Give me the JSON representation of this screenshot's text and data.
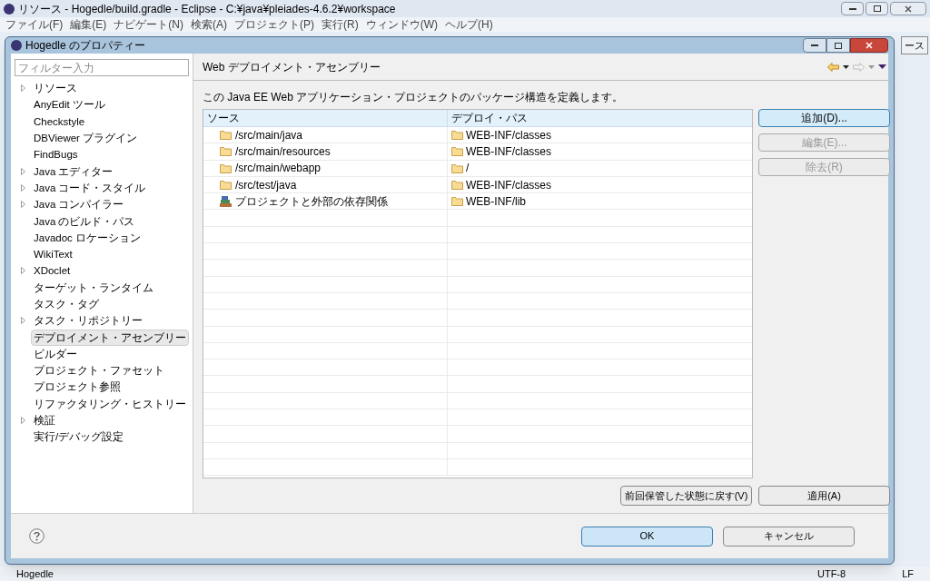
{
  "main_window": {
    "title": "リソース - Hogedle/build.gradle - Eclipse - C:¥java¥pleiades-4.6.2¥workspace",
    "menu": [
      "ファイル(F)",
      "編集(E)",
      "ナビゲート(N)",
      "検索(A)",
      "プロジェクト(P)",
      "実行(R)",
      "ウィンドウ(W)",
      "ヘルプ(H)"
    ],
    "perspective_tab": "ース",
    "status_project": "Hogedle",
    "status_encoding": "UTF-8",
    "status_line_ending": "LF"
  },
  "dialog": {
    "title": "Hogedle のプロパティー",
    "filter": {
      "placeholder": "フィルター入力"
    },
    "tree": [
      {
        "label": "リソース",
        "expandable": true,
        "selected": false
      },
      {
        "label": "AnyEdit ツール",
        "expandable": false,
        "selected": false
      },
      {
        "label": "Checkstyle",
        "expandable": false,
        "selected": false
      },
      {
        "label": "DBViewer プラグイン",
        "expandable": false,
        "selected": false
      },
      {
        "label": "FindBugs",
        "expandable": false,
        "selected": false
      },
      {
        "label": "Java エディター",
        "expandable": true,
        "selected": false
      },
      {
        "label": "Java コード・スタイル",
        "expandable": true,
        "selected": false
      },
      {
        "label": "Java コンパイラー",
        "expandable": true,
        "selected": false
      },
      {
        "label": "Java のビルド・パス",
        "expandable": false,
        "selected": false
      },
      {
        "label": "Javadoc ロケーション",
        "expandable": false,
        "selected": false
      },
      {
        "label": "WikiText",
        "expandable": false,
        "selected": false
      },
      {
        "label": "XDoclet",
        "expandable": true,
        "selected": false
      },
      {
        "label": "ターゲット・ランタイム",
        "expandable": false,
        "selected": false
      },
      {
        "label": "タスク・タグ",
        "expandable": false,
        "selected": false
      },
      {
        "label": "タスク・リポジトリー",
        "expandable": true,
        "selected": false
      },
      {
        "label": "デプロイメント・アセンブリー",
        "expandable": false,
        "selected": true
      },
      {
        "label": "ビルダー",
        "expandable": false,
        "selected": false
      },
      {
        "label": "プロジェクト・ファセット",
        "expandable": false,
        "selected": false
      },
      {
        "label": "プロジェクト参照",
        "expandable": false,
        "selected": false
      },
      {
        "label": "リファクタリング・ヒストリー",
        "expandable": false,
        "selected": false
      },
      {
        "label": "検証",
        "expandable": true,
        "selected": false
      },
      {
        "label": "実行/デバッグ設定",
        "expandable": false,
        "selected": false
      }
    ],
    "page_title": "Web デプロイメント・アセンブリー",
    "description": "この Java EE Web アプリケーション・プロジェクトのパッケージ構造を定義します。",
    "table": {
      "columns": [
        "ソース",
        "デプロイ・パス"
      ],
      "rows": [
        {
          "kind": "folder",
          "source": "/src/main/java",
          "deploy_path": "WEB-INF/classes"
        },
        {
          "kind": "folder",
          "source": "/src/main/resources",
          "deploy_path": "WEB-INF/classes"
        },
        {
          "kind": "folder",
          "source": "/src/main/webapp",
          "deploy_path": "/"
        },
        {
          "kind": "folder",
          "source": "/src/test/java",
          "deploy_path": "WEB-INF/classes"
        },
        {
          "kind": "library",
          "source": "プロジェクトと外部の依存関係",
          "deploy_path": "WEB-INF/lib"
        }
      ]
    },
    "side_buttons": [
      {
        "label": "追加(D)...",
        "disabled": false,
        "focused": true
      },
      {
        "label": "編集(E)...",
        "disabled": true,
        "focused": false
      },
      {
        "label": "除去(R)",
        "disabled": true,
        "focused": false
      }
    ],
    "restore_button": "前回保管した状態に戻す(V)",
    "apply_button": "適用(A)",
    "ok_button": "OK",
    "cancel_button": "キャンセル"
  }
}
